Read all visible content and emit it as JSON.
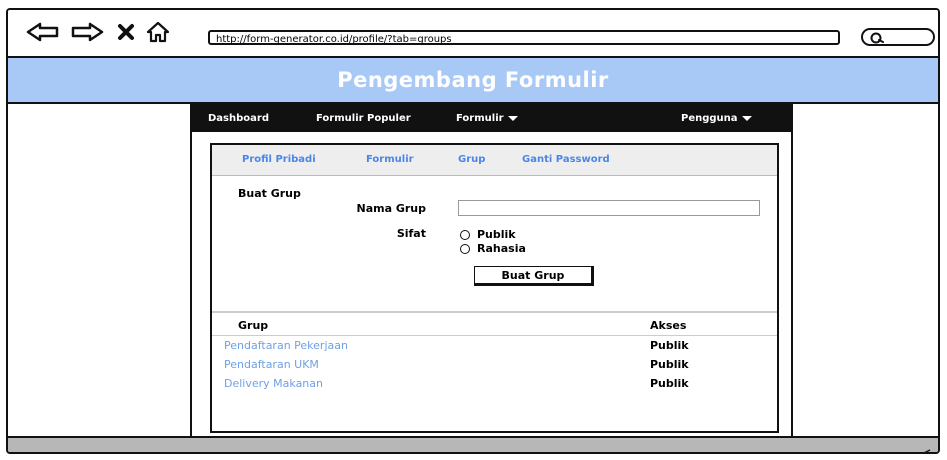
{
  "browser": {
    "url": "http://form-generator.co.id/profile/?tab=groups"
  },
  "banner": {
    "title": "Pengembang Formulir"
  },
  "menu": {
    "dashboard": "Dashboard",
    "popular": "Formulir Populer",
    "forms": "Formulir",
    "user": "Pengguna"
  },
  "tabs": {
    "profile": "Profil Pribadi",
    "forms": "Formulir",
    "group": "Grup",
    "password": "Ganti Password"
  },
  "create_group": {
    "section_title": "Buat Grup",
    "name_label": "Nama Grup",
    "name_value": "",
    "type_label": "Sifat",
    "option_public": "Publik",
    "option_secret": "Rahasia",
    "submit_label": "Buat Grup"
  },
  "groups_table": {
    "col_group": "Grup",
    "col_access": "Akses",
    "rows": [
      {
        "name": "Pendaftaran Pekerjaan",
        "access": "Publik"
      },
      {
        "name": "Pendaftaran UKM",
        "access": "Publik"
      },
      {
        "name": "Delivery Makanan",
        "access": "Publik"
      }
    ]
  },
  "colors": {
    "banner": "#a8c8f5",
    "link": "#4a86e8",
    "row_link": "#6fa0e8",
    "menubar": "#111111"
  }
}
